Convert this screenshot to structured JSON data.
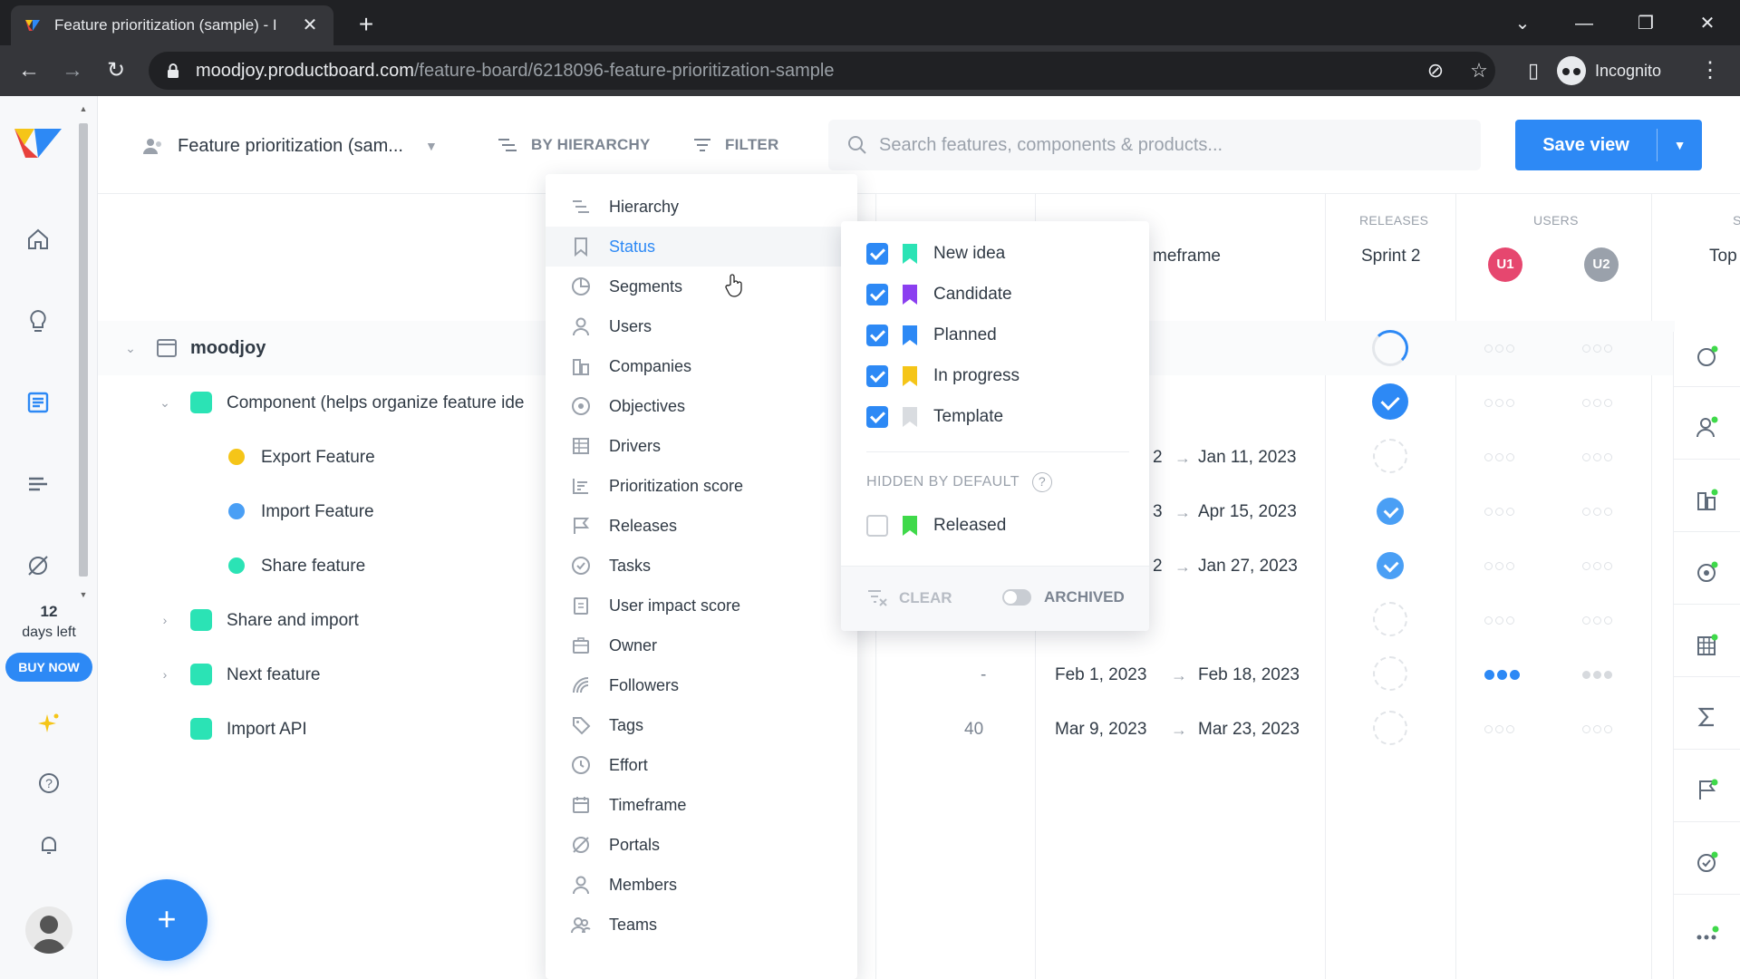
{
  "browser": {
    "tab_title": "Feature prioritization (sample) - I",
    "url_host": "moodjoy.productboard.com",
    "url_path": "/feature-board/6218096-feature-prioritization-sample",
    "profile_label": "Incognito"
  },
  "rail": {
    "trial_days": "12",
    "trial_label": "days left",
    "buy_label": "BUY NOW"
  },
  "header": {
    "board_title": "Feature prioritization (sam...",
    "hierarchy_label": "BY HIERARCHY",
    "filter_label": "FILTER",
    "search_placeholder": "Search features, components & products...",
    "save_label": "Save view"
  },
  "columns": {
    "timeframe_label": "meframe",
    "releases_head": "RELEASES",
    "releases_value": "Sprint 2",
    "users_head": "USERS",
    "user1": "U1",
    "user2": "U2",
    "top_label": "Top",
    "s_head": "S"
  },
  "rows": [
    {
      "title": "moodjoy",
      "kind": "product"
    },
    {
      "title": "Component (helps organize feature ide",
      "kind": "component",
      "color": "#2be3b5"
    },
    {
      "title": "Export Feature",
      "kind": "feature",
      "color": "#f5c518",
      "from": "2",
      "to": "Jan 11, 2023"
    },
    {
      "title": "Import Feature",
      "kind": "feature",
      "color": "#4a9ff5",
      "from": "3",
      "to": "Apr 15, 2023"
    },
    {
      "title": "Share feature",
      "kind": "feature",
      "color": "#2be3b5",
      "from": "2",
      "to": "Jan 27, 2023"
    },
    {
      "title": "Share and import",
      "kind": "component",
      "color": "#2be3b5"
    },
    {
      "title": "Next feature",
      "kind": "component",
      "color": "#2be3b5",
      "score": "-",
      "from": "Feb 1, 2023",
      "to": "Feb 18, 2023"
    },
    {
      "title": "Import API",
      "kind": "component",
      "color": "#2be3b5",
      "score": "40",
      "from": "Mar 9, 2023",
      "to": "Mar 23, 2023"
    }
  ],
  "groupby_menu": {
    "items": [
      "Hierarchy",
      "Status",
      "Segments",
      "Users",
      "Companies",
      "Objectives",
      "Drivers",
      "Prioritization score",
      "Releases",
      "Tasks",
      "User impact score",
      "Owner",
      "Followers",
      "Tags",
      "Effort",
      "Timeframe",
      "Portals",
      "Members",
      "Teams"
    ],
    "active": "Status"
  },
  "status_flyout": {
    "statuses": [
      {
        "label": "New idea",
        "color": "#2be3b5",
        "checked": true
      },
      {
        "label": "Candidate",
        "color": "#8b3ff0",
        "checked": true
      },
      {
        "label": "Planned",
        "color": "#2d89f5",
        "checked": true
      },
      {
        "label": "In progress",
        "color": "#f5c518",
        "checked": true
      },
      {
        "label": "Template",
        "color": "#d9dce0",
        "checked": true
      }
    ],
    "hidden_label": "HIDDEN BY DEFAULT",
    "hidden_statuses": [
      {
        "label": "Released",
        "color": "#3fd94a",
        "checked": false
      }
    ],
    "clear_label": "CLEAR",
    "archived_label": "ARCHIVED"
  }
}
